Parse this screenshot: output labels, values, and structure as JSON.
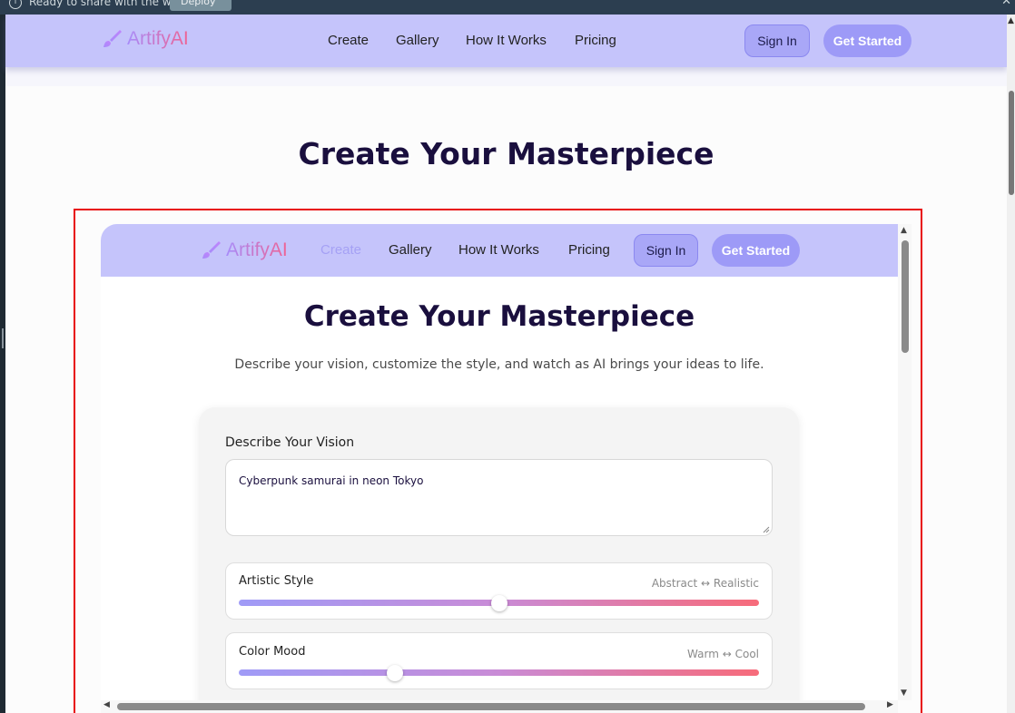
{
  "notification": {
    "message": "Ready to share with the world?",
    "deploy_label": "Deploy"
  },
  "brand": {
    "name": "ArtifyAI",
    "gradient_start": "#a78bfa",
    "gradient_end": "#f06292"
  },
  "nav": {
    "links": [
      "Create",
      "Gallery",
      "How It Works",
      "Pricing"
    ],
    "sign_in": "Sign In",
    "get_started": "Get Started"
  },
  "page": {
    "title": "Create Your Masterpiece"
  },
  "preview": {
    "nav": {
      "links": [
        "Create",
        "Gallery",
        "How It Works",
        "Pricing"
      ],
      "active": "Create",
      "sign_in": "Sign In",
      "get_started": "Get Started"
    },
    "title": "Create Your Masterpiece",
    "subtitle": "Describe your vision, customize the style, and watch as AI brings your ideas to life.",
    "form": {
      "vision_label": "Describe Your Vision",
      "vision_value": "Cyberpunk samurai in neon Tokyo",
      "sliders": [
        {
          "name": "Artistic Style",
          "range": "Abstract ↔ Realistic",
          "value": 0.5
        },
        {
          "name": "Color Mood",
          "range": "Warm ↔ Cool",
          "value": 0.3
        }
      ]
    }
  },
  "colors": {
    "navbar": "#c5c4fb",
    "accent": "#9d9af7",
    "title": "#1a0f3e",
    "highlight_border": "#e8090b"
  }
}
